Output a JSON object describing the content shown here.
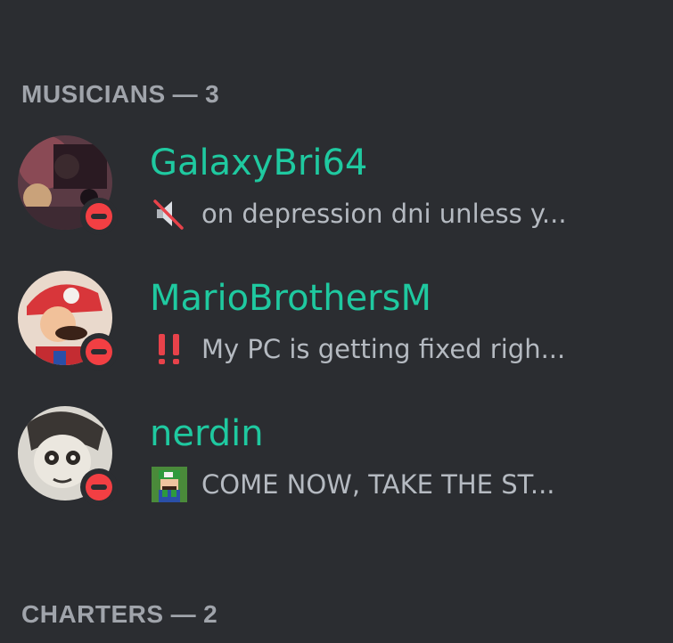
{
  "sections": [
    {
      "title": "MUSICIANS",
      "separator": "—",
      "count": "3"
    },
    {
      "title": "CHARTERS",
      "separator": "—",
      "count": "2"
    }
  ],
  "members": [
    {
      "username": "GalaxyBri64",
      "status": "do-not-disturb",
      "activity_icon": "muted-speaker-icon",
      "activity_text": "on depression dni unless y..."
    },
    {
      "username": "MarioBrothersM",
      "status": "do-not-disturb",
      "activity_icon": "double-exclamation-icon",
      "activity_text": "My PC is getting fixed righ..."
    },
    {
      "username": "nerdin",
      "status": "do-not-disturb",
      "activity_icon": "luigi-emoji-icon",
      "activity_text": "COME NOW, TAKE THE ST..."
    }
  ],
  "colors": {
    "background": "#2b2d31",
    "username": "#1fc9a0",
    "header": "#a0a4ab",
    "activity": "#b5bac1",
    "dnd": "#f23f43"
  }
}
